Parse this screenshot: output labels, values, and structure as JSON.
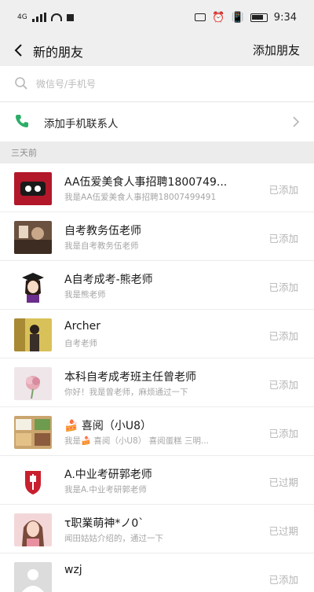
{
  "status_bar": {
    "left_signal_label": "4G",
    "time": "9:34"
  },
  "nav": {
    "title": "新的朋友",
    "action": "添加朋友"
  },
  "search": {
    "placeholder": "微信号/手机号"
  },
  "add_contacts": {
    "label": "添加手机联系人"
  },
  "section": {
    "label": "三天前"
  },
  "friends": [
    {
      "name": "AA伍爱美食人事招聘1800749...",
      "message": "我是AA伍爱美食人事招聘18007499491",
      "status": "已添加",
      "avatar": "red-brand-avatar"
    },
    {
      "name": "自考教务伍老师",
      "message": "我是自考教务伍老师",
      "status": "已添加",
      "avatar": "photo-avatar"
    },
    {
      "name": "A自考成考-熊老师",
      "message": "我是熊老师",
      "status": "已添加",
      "avatar": "graduate-cartoon-avatar"
    },
    {
      "name": "Archer",
      "message": "自考老师",
      "status": "已添加",
      "avatar": "photo-avatar"
    },
    {
      "name": "本科自考成考班主任曾老师",
      "message": "你好！我是曾老师，麻烦通过一下",
      "status": "已添加",
      "avatar": "flower-avatar"
    },
    {
      "name": "🍰 喜阅（小U8）",
      "message": "我是🍰 喜阅（小U8） 喜阅蛋糕 三明...",
      "status": "已添加",
      "avatar": "food-photo-avatar"
    },
    {
      "name": "A.中业考研郭老师",
      "message": "我是A.中业考研郭老师",
      "status": "已过期",
      "avatar": "red-logo-avatar"
    },
    {
      "name": "τ职業萌神*ノ0`",
      "message": "闻田姑姑介绍的，通过一下",
      "status": "已过期",
      "avatar": "portrait-avatar"
    },
    {
      "name": "wzj",
      "message": "",
      "status": "已添加",
      "avatar": "default-avatar"
    }
  ],
  "colors": {
    "accent_green": "#2aae67",
    "bar_bg": "#efefef",
    "section_bg": "#ececec",
    "muted_text": "#a6a6a6"
  }
}
